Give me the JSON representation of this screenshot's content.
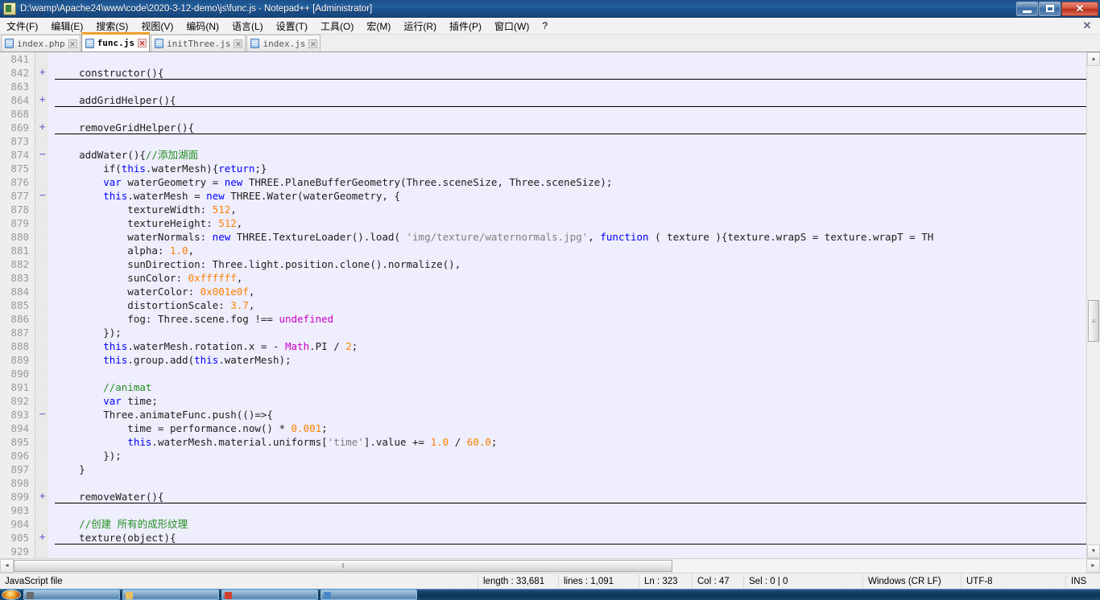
{
  "window": {
    "title": "D:\\wamp\\Apache24\\www\\code\\2020-3-12-demo\\js\\func.js - Notepad++ [Administrator]",
    "icon": "notepadpp-icon",
    "minimize_label": "–",
    "maximize_label": "❐",
    "close_label": "✕"
  },
  "menu": {
    "items": [
      {
        "label": "文件(F)"
      },
      {
        "label": "编辑(E)"
      },
      {
        "label": "搜索(S)"
      },
      {
        "label": "视图(V)"
      },
      {
        "label": "编码(N)"
      },
      {
        "label": "语言(L)"
      },
      {
        "label": "设置(T)"
      },
      {
        "label": "工具(O)"
      },
      {
        "label": "宏(M)"
      },
      {
        "label": "运行(R)"
      },
      {
        "label": "插件(P)"
      },
      {
        "label": "窗口(W)"
      },
      {
        "label": "?"
      }
    ],
    "close_document_label": "✕"
  },
  "tabs": [
    {
      "label": "index.php",
      "active": false,
      "close_label": "✕"
    },
    {
      "label": "func.js",
      "active": true,
      "close_label": "✕"
    },
    {
      "label": "initThree.js",
      "active": false,
      "close_label": "✕"
    },
    {
      "label": "index.js",
      "active": false,
      "close_label": "✕"
    }
  ],
  "editor": {
    "lines": [
      {
        "n": "841",
        "fold": "",
        "folded": false,
        "tokens": []
      },
      {
        "n": "842",
        "fold": "plus",
        "folded": true,
        "tokens": [
          {
            "t": "    constructor(){",
            "c": "op"
          }
        ]
      },
      {
        "n": "863",
        "fold": "",
        "folded": false,
        "tokens": []
      },
      {
        "n": "864",
        "fold": "plus",
        "folded": true,
        "tokens": [
          {
            "t": "    addGridHelper(){",
            "c": "op"
          }
        ]
      },
      {
        "n": "868",
        "fold": "",
        "folded": false,
        "tokens": []
      },
      {
        "n": "869",
        "fold": "plus",
        "folded": true,
        "tokens": [
          {
            "t": "    removeGridHelper(){",
            "c": "op"
          }
        ]
      },
      {
        "n": "873",
        "fold": "",
        "folded": false,
        "tokens": []
      },
      {
        "n": "874",
        "fold": "minus",
        "folded": false,
        "tokens": [
          {
            "t": "    addWater(){",
            "c": "op"
          },
          {
            "t": "//添加湖面",
            "c": "cmt"
          }
        ]
      },
      {
        "n": "875",
        "fold": "",
        "folded": false,
        "tokens": [
          {
            "t": "        if(",
            "c": "op"
          },
          {
            "t": "this",
            "c": "kw"
          },
          {
            "t": ".waterMesh){",
            "c": "op"
          },
          {
            "t": "return",
            "c": "kw"
          },
          {
            "t": ";}",
            "c": "op"
          }
        ]
      },
      {
        "n": "876",
        "fold": "",
        "folded": false,
        "tokens": [
          {
            "t": "        ",
            "c": "op"
          },
          {
            "t": "var",
            "c": "kw"
          },
          {
            "t": " waterGeometry = ",
            "c": "op"
          },
          {
            "t": "new",
            "c": "kw"
          },
          {
            "t": " THREE.PlaneBufferGeometry(Three.sceneSize, Three.sceneSize);",
            "c": "op"
          }
        ]
      },
      {
        "n": "877",
        "fold": "minus",
        "folded": false,
        "tokens": [
          {
            "t": "        ",
            "c": "op"
          },
          {
            "t": "this",
            "c": "kw"
          },
          {
            "t": ".waterMesh = ",
            "c": "op"
          },
          {
            "t": "new",
            "c": "kw"
          },
          {
            "t": " THREE.Water(waterGeometry, {",
            "c": "op"
          }
        ]
      },
      {
        "n": "878",
        "fold": "",
        "folded": false,
        "tokens": [
          {
            "t": "            textureWidth: ",
            "c": "op"
          },
          {
            "t": "512",
            "c": "num"
          },
          {
            "t": ",",
            "c": "op"
          }
        ]
      },
      {
        "n": "879",
        "fold": "",
        "folded": false,
        "tokens": [
          {
            "t": "            textureHeight: ",
            "c": "op"
          },
          {
            "t": "512",
            "c": "num"
          },
          {
            "t": ",",
            "c": "op"
          }
        ]
      },
      {
        "n": "880",
        "fold": "",
        "folded": false,
        "tokens": [
          {
            "t": "            waterNormals: ",
            "c": "op"
          },
          {
            "t": "new",
            "c": "kw"
          },
          {
            "t": " THREE.TextureLoader().load( ",
            "c": "op"
          },
          {
            "t": "'img/texture/waternormals.jpg'",
            "c": "str"
          },
          {
            "t": ", ",
            "c": "op"
          },
          {
            "t": "function",
            "c": "kw"
          },
          {
            "t": " ( texture ){texture.wrapS = texture.wrapT = TH",
            "c": "op"
          }
        ]
      },
      {
        "n": "881",
        "fold": "",
        "folded": false,
        "tokens": [
          {
            "t": "            alpha: ",
            "c": "op"
          },
          {
            "t": "1.0",
            "c": "num"
          },
          {
            "t": ",",
            "c": "op"
          }
        ]
      },
      {
        "n": "882",
        "fold": "",
        "folded": false,
        "tokens": [
          {
            "t": "            sunDirection: Three.light.position.clone().normalize(),",
            "c": "op"
          }
        ]
      },
      {
        "n": "883",
        "fold": "",
        "folded": false,
        "tokens": [
          {
            "t": "            sunColor: ",
            "c": "op"
          },
          {
            "t": "0xffffff",
            "c": "num"
          },
          {
            "t": ",",
            "c": "op"
          }
        ]
      },
      {
        "n": "884",
        "fold": "",
        "folded": false,
        "tokens": [
          {
            "t": "            waterColor: ",
            "c": "op"
          },
          {
            "t": "0x001e0f",
            "c": "num"
          },
          {
            "t": ",",
            "c": "op"
          }
        ]
      },
      {
        "n": "885",
        "fold": "",
        "folded": false,
        "tokens": [
          {
            "t": "            distortionScale: ",
            "c": "op"
          },
          {
            "t": "3.7",
            "c": "num"
          },
          {
            "t": ",",
            "c": "op"
          }
        ]
      },
      {
        "n": "886",
        "fold": "",
        "folded": false,
        "tokens": [
          {
            "t": "            fog: Three.scene.fog !== ",
            "c": "op"
          },
          {
            "t": "undefined",
            "c": "spec"
          }
        ]
      },
      {
        "n": "887",
        "fold": "",
        "folded": false,
        "tokens": [
          {
            "t": "        });",
            "c": "op"
          }
        ]
      },
      {
        "n": "888",
        "fold": "",
        "folded": false,
        "tokens": [
          {
            "t": "        ",
            "c": "op"
          },
          {
            "t": "this",
            "c": "kw"
          },
          {
            "t": ".waterMesh.rotation.x = - ",
            "c": "op"
          },
          {
            "t": "Math",
            "c": "spec"
          },
          {
            "t": ".PI / ",
            "c": "op"
          },
          {
            "t": "2",
            "c": "num"
          },
          {
            "t": ";",
            "c": "op"
          }
        ]
      },
      {
        "n": "889",
        "fold": "",
        "folded": false,
        "tokens": [
          {
            "t": "        ",
            "c": "op"
          },
          {
            "t": "this",
            "c": "kw"
          },
          {
            "t": ".group.add(",
            "c": "op"
          },
          {
            "t": "this",
            "c": "kw"
          },
          {
            "t": ".waterMesh);",
            "c": "op"
          }
        ]
      },
      {
        "n": "890",
        "fold": "",
        "folded": false,
        "tokens": []
      },
      {
        "n": "891",
        "fold": "",
        "folded": false,
        "tokens": [
          {
            "t": "        //animat",
            "c": "cmt"
          }
        ]
      },
      {
        "n": "892",
        "fold": "",
        "folded": false,
        "tokens": [
          {
            "t": "        ",
            "c": "op"
          },
          {
            "t": "var",
            "c": "kw"
          },
          {
            "t": " time;",
            "c": "op"
          }
        ]
      },
      {
        "n": "893",
        "fold": "minus",
        "folded": false,
        "tokens": [
          {
            "t": "        Three.animateFunc.push(()=>{",
            "c": "op"
          }
        ]
      },
      {
        "n": "894",
        "fold": "",
        "folded": false,
        "tokens": [
          {
            "t": "            time = performance.now() * ",
            "c": "op"
          },
          {
            "t": "0.001",
            "c": "num"
          },
          {
            "t": ";",
            "c": "op"
          }
        ]
      },
      {
        "n": "895",
        "fold": "",
        "folded": false,
        "tokens": [
          {
            "t": "            ",
            "c": "op"
          },
          {
            "t": "this",
            "c": "kw"
          },
          {
            "t": ".waterMesh.material.uniforms[",
            "c": "op"
          },
          {
            "t": "'time'",
            "c": "str"
          },
          {
            "t": "].value += ",
            "c": "op"
          },
          {
            "t": "1.0",
            "c": "num"
          },
          {
            "t": " / ",
            "c": "op"
          },
          {
            "t": "60.0",
            "c": "num"
          },
          {
            "t": ";",
            "c": "op"
          }
        ]
      },
      {
        "n": "896",
        "fold": "",
        "folded": false,
        "tokens": [
          {
            "t": "        });",
            "c": "op"
          }
        ]
      },
      {
        "n": "897",
        "fold": "",
        "folded": false,
        "tokens": [
          {
            "t": "    }",
            "c": "op"
          }
        ]
      },
      {
        "n": "898",
        "fold": "",
        "folded": false,
        "tokens": []
      },
      {
        "n": "899",
        "fold": "plus",
        "folded": true,
        "tokens": [
          {
            "t": "    removeWater(){",
            "c": "op"
          }
        ]
      },
      {
        "n": "903",
        "fold": "",
        "folded": false,
        "tokens": []
      },
      {
        "n": "904",
        "fold": "",
        "folded": false,
        "tokens": [
          {
            "t": "    //创建 所有的成形纹理",
            "c": "cmt"
          }
        ]
      },
      {
        "n": "905",
        "fold": "plus",
        "folded": true,
        "tokens": [
          {
            "t": "    texture(object){",
            "c": "op"
          }
        ]
      },
      {
        "n": "929",
        "fold": "",
        "folded": false,
        "tokens": []
      }
    ],
    "vscroll": {
      "up_label": "▲",
      "down_label": "▼",
      "thumb_grip": "≡"
    },
    "hscroll": {
      "left_label": "◄",
      "right_label": "►",
      "thumb_grip": "‖"
    }
  },
  "statusbar": {
    "file_type": "JavaScript file",
    "length": "length : 33,681",
    "lines": "lines : 1,091",
    "ln": "Ln : 323",
    "col": "Col : 47",
    "sel": "Sel : 0 | 0",
    "eol": "Windows (CR LF)",
    "encoding": "UTF-8",
    "insert_mode": "INS"
  },
  "taskbar": {
    "start_label": "start",
    "items": [
      {
        "label": ""
      },
      {
        "label": ""
      },
      {
        "label": ""
      },
      {
        "label": ""
      }
    ]
  },
  "colors": {
    "title_blue": "#1d5391",
    "editor_bg": "#eeeefc",
    "keyword": "#0000ff",
    "number": "#ff8000",
    "comment": "#248f24",
    "string": "#808080",
    "special": "#cc00cc",
    "fold_marker": "#7c6fd0",
    "active_tab_accent": "#f0a030"
  }
}
